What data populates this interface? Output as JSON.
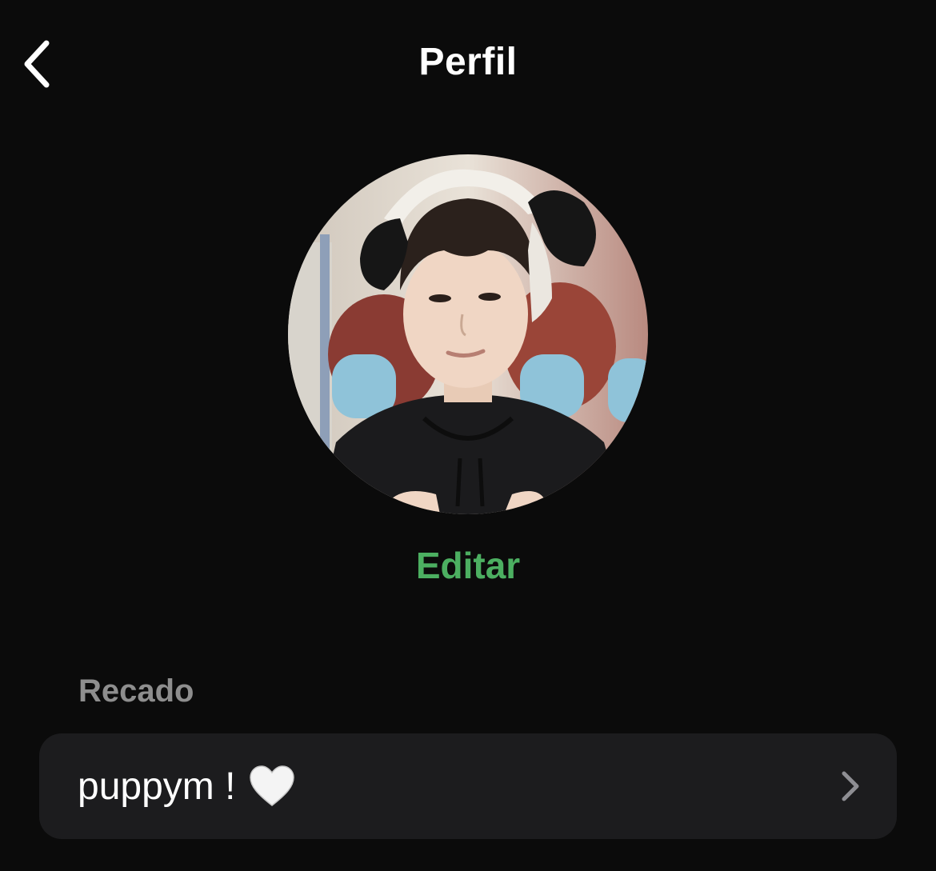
{
  "header": {
    "back_icon": "chevron-left-icon",
    "title": "Perfil"
  },
  "profile": {
    "avatar_icon": "avatar-photo",
    "edit_label": "Editar",
    "edit_color": "#4caf61"
  },
  "status_section": {
    "label": "Recado",
    "value": "puppym !",
    "emoji_icon": "white-heart-icon",
    "chevron_icon": "chevron-right-icon"
  },
  "colors": {
    "background": "#0b0b0b",
    "row_background": "#1c1c1e",
    "secondary_text": "#8e8e8e",
    "accent": "#4caf61"
  }
}
